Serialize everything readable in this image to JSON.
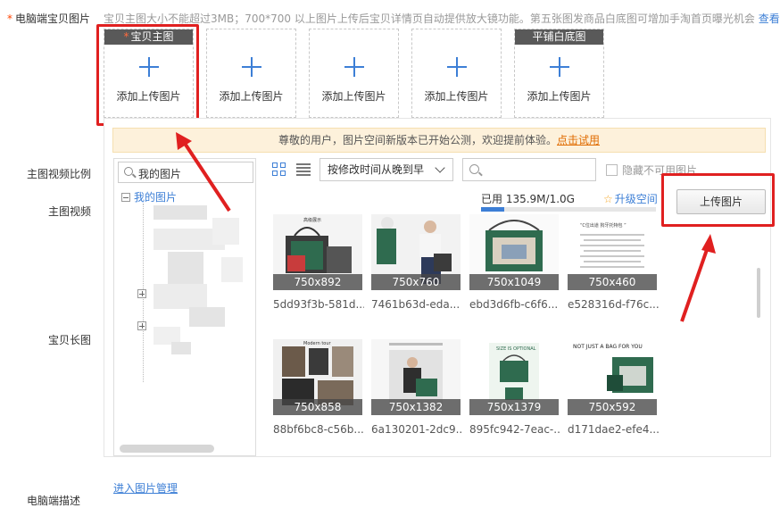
{
  "header": {
    "required_star": "*",
    "field_label": "电脑端宝贝图片",
    "hint_text": "宝贝主图大小不能超过3MB；700*700 以上图片上传后宝贝详情页自动提供放大镜功能。第五张图发商品白底图可增加手淘首页曝光机会",
    "hint_link": "查看规"
  },
  "slots": [
    {
      "tag": "宝贝主图",
      "tag_star": "*",
      "label": "添加上传图片"
    },
    {
      "tag": "",
      "label": "添加上传图片"
    },
    {
      "tag": "",
      "label": "添加上传图片"
    },
    {
      "tag": "",
      "label": "添加上传图片"
    },
    {
      "tag": "平铺白底图",
      "label": "添加上传图片"
    }
  ],
  "fields": {
    "video_ratio": "主图视频比例",
    "main_video": "主图视频",
    "long_image": "宝贝长图",
    "next_cut": "电脑端描述"
  },
  "notice": {
    "text": "尊敬的用户，图片空间新版本已开始公测，欢迎提前体验。",
    "link": "点击试用"
  },
  "tree": {
    "search_value": "我的图片",
    "root_label": "我的图片"
  },
  "toolbar": {
    "sort_value": "按修改时间从晚到早",
    "search_placeholder": "",
    "hide_unusable_label": "隐藏不可用图片"
  },
  "storage": {
    "used_label": "已用 135.9M/1.0G",
    "used_fraction": 0.133,
    "upgrade_label": "升级空间"
  },
  "upload_button": "上传图片",
  "images": [
    {
      "size": "750x892",
      "name": "5dd93f3b-581d..."
    },
    {
      "size": "750x760",
      "name": "7461b63d-eda..."
    },
    {
      "size": "750x1049",
      "name": "ebd3d6fb-c6f6..."
    },
    {
      "size": "750x460",
      "name": "e528316d-f76c..."
    },
    {
      "size": "750x858",
      "name": "88bf6bc8-c56b..."
    },
    {
      "size": "750x1382",
      "name": "6a130201-2dc9..."
    },
    {
      "size": "750x1379",
      "name": "895fc942-7eac-..."
    },
    {
      "size": "750x592",
      "name": "d171dae2-efe4..."
    }
  ],
  "thumb_texts": {
    "t1": "高级展示",
    "t4": "“C位出道 狗牙托特包 ”",
    "t5": "Modern tour",
    "t7": "SIZE IS OPTIONAL",
    "t8": "NOT JUST A BAG FOR YOU"
  },
  "footer": {
    "manage_link": "进入图片管理"
  },
  "colors": {
    "accent_blue": "#3d7fd6",
    "highlight_red": "#e02020",
    "notice_bg": "#fdf1db",
    "bag_green": "#2f6b4f"
  }
}
